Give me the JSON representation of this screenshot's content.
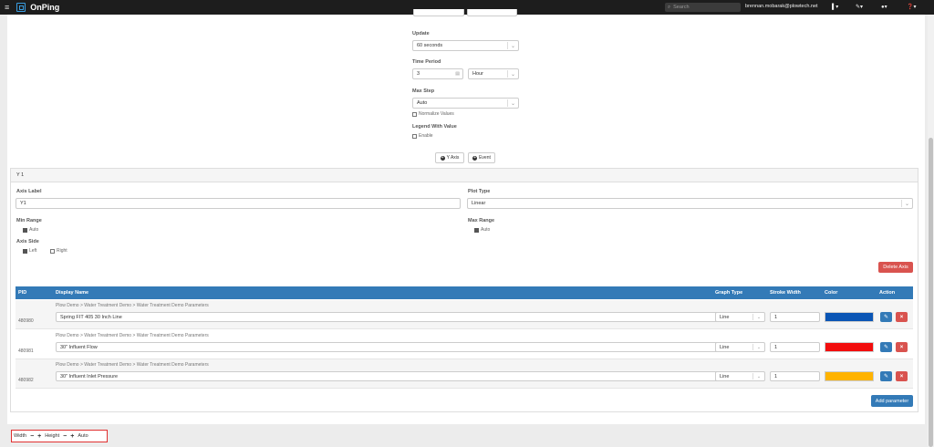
{
  "topbar": {
    "menu_glyph": "≡",
    "app_name": "OnPing",
    "search_placeholder": "Search",
    "user_email": "brennan.mobarak@plowtech.net",
    "icons": [
      "bookmark-icon",
      "wrench-icon",
      "user-icon",
      "help-icon"
    ],
    "icon_glyphs": [
      "▌▾",
      "✎▾",
      "●▾",
      "❓▾"
    ]
  },
  "settings": {
    "update_label": "Update",
    "update_value": "60 seconds",
    "time_period_label": "Time Period",
    "time_period_value": "3",
    "time_period_unit": "Hour",
    "max_step_label": "Max Step",
    "max_step_value": "Auto",
    "normalize_label": "Normalize Values",
    "normalize_checked": false,
    "legend_label": "Legend With Value",
    "enable_label": "Enable",
    "enable_checked": false,
    "y_axis_button": "Y Axis",
    "event_button": "Event"
  },
  "axis": {
    "title": "Y 1",
    "axis_label_label": "Axis Label",
    "axis_label_value": "Y1",
    "plot_type_label": "Plot Type",
    "plot_type_value": "Linear",
    "min_range_label": "Min Range",
    "min_auto_label": "Auto",
    "min_auto_checked": true,
    "max_range_label": "Max Range",
    "max_auto_label": "Auto",
    "max_auto_checked": true,
    "axis_side_label": "Axis Side",
    "side_left_label": "Left",
    "side_left_checked": true,
    "side_right_label": "Right",
    "side_right_checked": false,
    "delete_axis_button": "Delete Axis"
  },
  "table": {
    "headers": {
      "pid": "PID",
      "display_name": "Display Name",
      "graph_type": "Graph Type",
      "stroke_width": "Stroke Width",
      "color": "Color",
      "action": "Action"
    },
    "rows": [
      {
        "pid": "480980",
        "breadcrumb": "Plow Demo > Water Treatment Demo > Water Treatment Demo Parameters",
        "display_name": "Spring FIT 405 30 Inch Line",
        "graph_type": "Line",
        "stroke_width": "1",
        "color": "#0a55b5"
      },
      {
        "pid": "480981",
        "breadcrumb": "Plow Demo > Water Treatment Demo > Water Treatment Demo Parameters",
        "display_name": "30\" Influent Flow",
        "graph_type": "Line",
        "stroke_width": "1",
        "color": "#f20d0d"
      },
      {
        "pid": "480982",
        "breadcrumb": "Plow Demo > Water Treatment Demo > Water Treatment Demo Parameters",
        "display_name": "30\" Influent Inlet Pressure",
        "graph_type": "Line",
        "stroke_width": "1",
        "color": "#ffb300"
      }
    ],
    "add_parameter_button": "Add parameter"
  },
  "sizebar": {
    "width_label": "Width",
    "height_label": "Height",
    "minus": "−",
    "plus": "+",
    "auto_label": "Auto"
  }
}
